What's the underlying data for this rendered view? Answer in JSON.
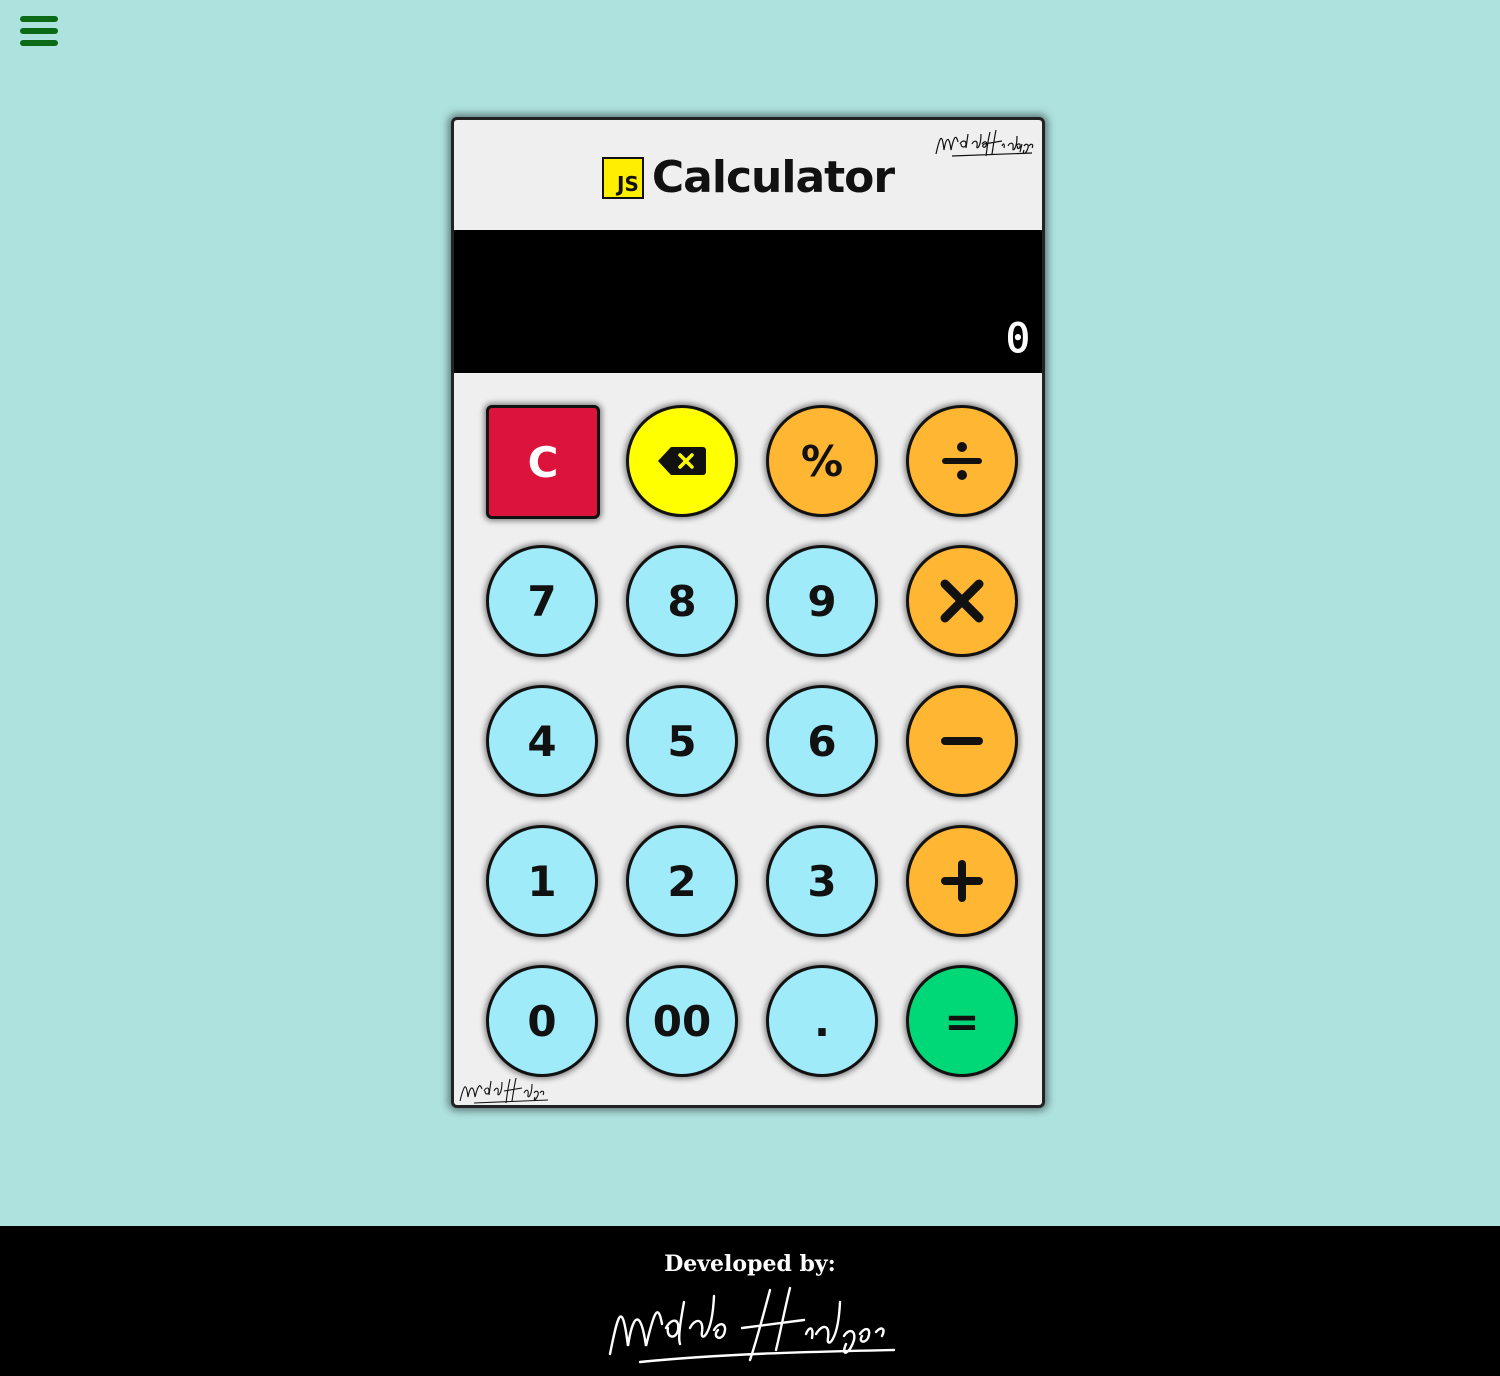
{
  "menu": {
    "icon": "hamburger-menu-icon",
    "color": "#0a6a16"
  },
  "header": {
    "logo_text": "JS",
    "title": "Calculator",
    "signature": "Waldo Hidalgo"
  },
  "display": {
    "value": "0"
  },
  "keys": {
    "row1": [
      "C",
      "backspace",
      "%",
      "÷"
    ],
    "row2": [
      "7",
      "8",
      "9",
      "×"
    ],
    "row3": [
      "4",
      "5",
      "6",
      "−"
    ],
    "row4": [
      "1",
      "2",
      "3",
      "+"
    ],
    "row5": [
      "0",
      "00",
      ".",
      "="
    ]
  },
  "labels": {
    "clear": "C",
    "percent": "%",
    "divide": "÷",
    "multiply": "✕",
    "minus": "−",
    "plus": "+",
    "seven": "7",
    "eight": "8",
    "nine": "9",
    "four": "4",
    "five": "5",
    "six": "6",
    "one": "1",
    "two": "2",
    "three": "3",
    "zero": "0",
    "double_zero": "00",
    "decimal": ".",
    "equals": "="
  },
  "colors": {
    "background": "#aee2df",
    "number_key": "#a0ebfa",
    "operator_key": "#ffb733",
    "backspace_key": "#ffff00",
    "equals_key": "#00d877",
    "clear_key": "#dc143c",
    "js_logo": "#ffee00"
  },
  "footer": {
    "label": "Developed by:",
    "signature": "Waldo Hidalgo"
  }
}
